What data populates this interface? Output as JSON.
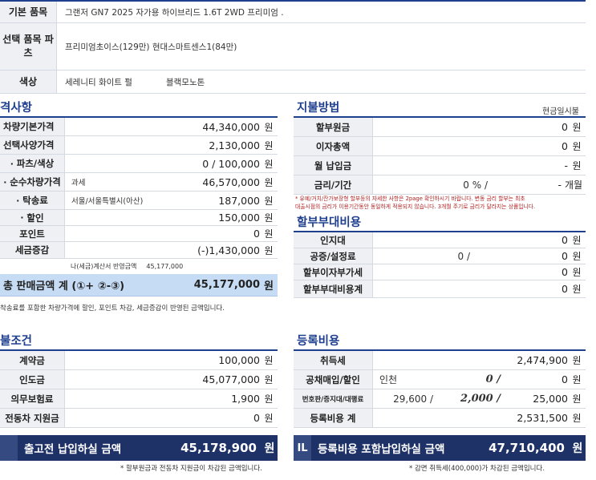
{
  "spec": {
    "model_label": "기본 품목",
    "model_value": "그랜저 GN7 2025 자가용 하이브리드 1.6T 2WD 프리미엄 .",
    "option_label": "선택 품목 파츠",
    "option_value": "프리미엄초이스(129만) 현대스마트센스1(84만)",
    "color_label": "색상",
    "color_ext": "세레니티 화이트 펄",
    "color_int": "블랙모노톤"
  },
  "price": {
    "title": "격사항",
    "rows": [
      {
        "label": "차량기본가격",
        "mid": "",
        "amount": "44,340,000",
        "unit": "원"
      },
      {
        "label": "선택사양가격",
        "mid": "",
        "amount": "2,130,000",
        "unit": "원"
      },
      {
        "label": "파츠/색상",
        "mid": "",
        "amount": "0 / 100,000",
        "unit": "원"
      },
      {
        "label": "순수차량가격",
        "mid": "과세",
        "amount": "46,570,000",
        "unit": "원"
      },
      {
        "label": "탁송료",
        "mid": "서울/서울특별시(아산)",
        "amount": "187,000",
        "unit": "원"
      },
      {
        "label": "할인",
        "mid": "",
        "amount": "150,000",
        "unit": "원"
      },
      {
        "label": "포인트",
        "mid": "",
        "amount": "0",
        "unit": "원"
      },
      {
        "label": "세금증감",
        "mid": "",
        "amount": "(-)1,430,000",
        "unit": "원"
      }
    ],
    "invoice_note_label": "나(세금)계산서 반영금액",
    "invoice_note_value": "45,177,000",
    "total_label": "총 판매금액 계 (①+ ②-③)",
    "total_value": "45,177,000",
    "total_unit": "원",
    "total_note": "착송료를 포함한 차량가격에 할인, 포인트 차감, 세금증감이 반영된 금액입니다."
  },
  "payment_method": {
    "title": "지불방법",
    "type": "현금일시불",
    "rows": [
      {
        "label": "할부원금",
        "amount": "0",
        "unit": "원"
      },
      {
        "label": "이자총액",
        "amount": "0",
        "unit": "원"
      },
      {
        "label": "월 납입금",
        "amount": "-",
        "unit": "원"
      },
      {
        "label": "금리/기간",
        "rate": "0 %  /",
        "amount": "-",
        "unit": "개월"
      }
    ],
    "notes": [
      "* 유예/거치/잔가보장형 할부등의 자세한 사항은 2page 확인하시기 바랍니다. 변동 금리 할부는 최초",
      "대출시점의 금리가 이용기간동안 동일하게 적용되지 않습니다. 3개월 주기로 금리가 달라지는 상품입니다."
    ]
  },
  "installment_fee": {
    "title": "할부부대비용",
    "rows": [
      {
        "label": "인지대",
        "mid": "",
        "amount": "0",
        "unit": "원"
      },
      {
        "label": "공증/설정료",
        "mid": "0 /",
        "amount": "0",
        "unit": "원"
      },
      {
        "label": "할부이자부가세",
        "mid": "",
        "amount": "0",
        "unit": "원"
      },
      {
        "label": "할부부대비용계",
        "mid": "",
        "amount": "0",
        "unit": "원"
      }
    ]
  },
  "pay_terms": {
    "title": "불조건",
    "rows": [
      {
        "label": "계약금",
        "amount": "100,000",
        "unit": "원"
      },
      {
        "label": "인도금",
        "amount": "45,077,000",
        "unit": "원"
      },
      {
        "label": "의무보험료",
        "amount": "1,900",
        "unit": "원"
      },
      {
        "label": "전동차 지원금",
        "amount": "0",
        "unit": "원"
      }
    ],
    "bar_badge": "",
    "bar_label": "출고전 납입하실 금액",
    "bar_value": "45,178,900",
    "bar_unit": "원",
    "bar_note": "* 할부원금과 전동차 지원금이 차감된 금액입니다."
  },
  "registration": {
    "title": "등록비용",
    "rows": [
      {
        "label": "취득세",
        "a": "",
        "b": "",
        "amount": "2,474,900",
        "unit": "원"
      },
      {
        "label": "공채매입/할인",
        "a": "인천",
        "b": "0 /",
        "amount": "0",
        "unit": "원"
      },
      {
        "label": "번호판/증지대/대행료",
        "a": "29,600 /",
        "b": "2,000 /",
        "amount": "25,000",
        "unit": "원"
      },
      {
        "label": "등록비용 계",
        "a": "",
        "b": "",
        "amount": "2,531,500",
        "unit": "원"
      }
    ],
    "bar_badge": "IL",
    "bar_label": "등록비용 포함납입하실 금액",
    "bar_value": "47,710,400",
    "bar_unit": "원",
    "bar_note": "* 감면 취득세(400,000)가 차감된 금액입니다."
  },
  "colors": {
    "accent": "#1f3f8f",
    "bar": "#1e3268",
    "total_row": "#c6dcf4",
    "label_bg": "#eef0f4"
  }
}
